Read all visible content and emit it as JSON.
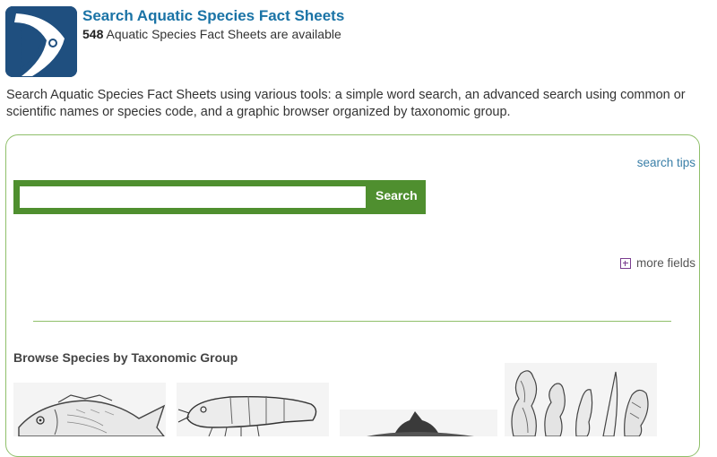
{
  "header": {
    "title": "Search Aquatic Species Fact Sheets",
    "count": "548",
    "count_text": "Aquatic Species Fact Sheets are available",
    "logo_icon": "fish-logo-icon"
  },
  "intro": "Search Aquatic Species Fact Sheets using various tools: a simple word search, an advanced search using common or scientific names or species code, and a graphic browser organized by taxonomic group.",
  "search": {
    "tips_label": "search tips",
    "input_value": "",
    "button_label": "Search",
    "more_fields_label": "more fields"
  },
  "browse": {
    "heading": "Browse Species by Taxonomic Group",
    "groups": [
      {
        "icon": "fish-icon"
      },
      {
        "icon": "shrimp-icon"
      },
      {
        "icon": "dolphin-icon"
      },
      {
        "icon": "seaweed-icon"
      }
    ]
  },
  "colors": {
    "title": "#1a73a6",
    "accent_green": "#4f8f2f",
    "panel_border": "#8fbf6a",
    "logo_bg": "#1f4f7f"
  }
}
